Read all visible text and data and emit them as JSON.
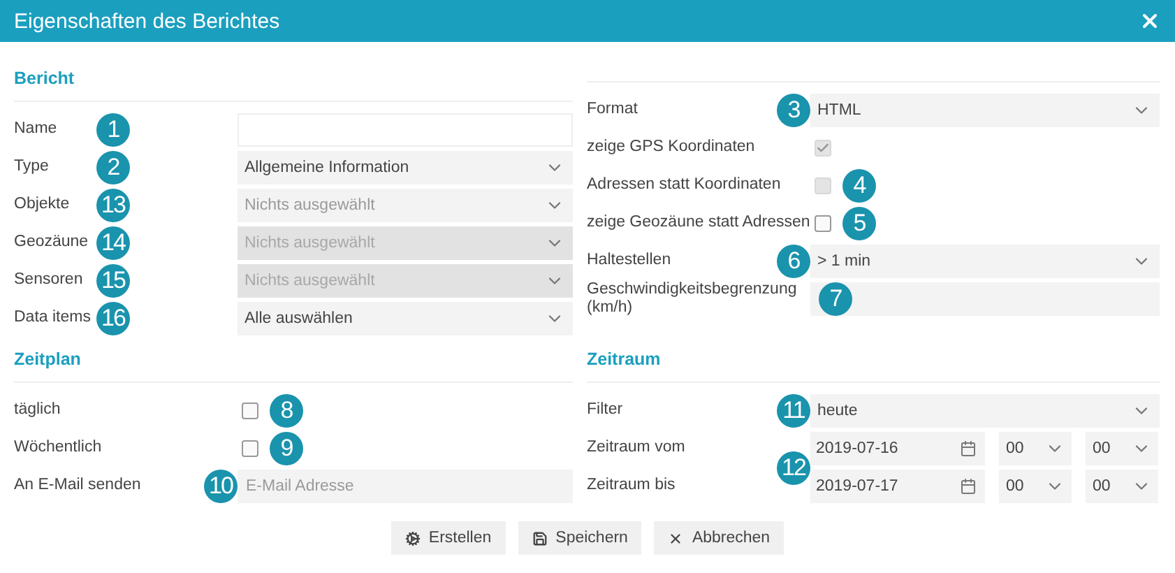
{
  "window": {
    "title": "Eigenschaften des Berichtes"
  },
  "bericht": {
    "title": "Bericht",
    "left": [
      {
        "kind": "text",
        "label": "Name",
        "badge": "1"
      },
      {
        "kind": "select",
        "label": "Type",
        "badge": "2",
        "value": "Allgemeine Information",
        "disabled": false
      },
      {
        "kind": "select",
        "label": "Objekte",
        "badge": "13",
        "placeholder": "Nichts ausgewählt",
        "disabled": false
      },
      {
        "kind": "select",
        "label": "Geozäune",
        "badge": "14",
        "placeholder": "Nichts ausgewählt",
        "disabled": true
      },
      {
        "kind": "select",
        "label": "Sensoren",
        "badge": "15",
        "placeholder": "Nichts ausgewählt",
        "disabled": true
      },
      {
        "kind": "select",
        "label": "Data items",
        "badge": "16",
        "value": "Alle auswählen",
        "disabled": false
      }
    ],
    "right": [
      {
        "kind": "select",
        "label": "Format",
        "badge": "3",
        "value": "HTML",
        "disabled": false
      },
      {
        "kind": "checkbox",
        "label": "zeige GPS Koordinaten",
        "checked": true,
        "disabled": true
      },
      {
        "kind": "checkbox",
        "label": "Adressen statt Koordinaten",
        "badge": "4",
        "checked": false,
        "disabled": true
      },
      {
        "kind": "checkbox",
        "label": "zeige Geozäune statt Adressen",
        "badge": "5",
        "checked": false,
        "disabled": false
      },
      {
        "kind": "select",
        "label": "Haltestellen",
        "badge": "6",
        "value": "> 1 min",
        "disabled": false
      },
      {
        "kind": "number",
        "label": "Geschwindigkeitsbegrenzung (km/h)",
        "badge": "7"
      }
    ]
  },
  "zeitplan": {
    "title": "Zeitplan",
    "rows": [
      {
        "kind": "checkbox",
        "label": "täglich",
        "badge": "8",
        "checked": false,
        "disabled": false
      },
      {
        "kind": "checkbox",
        "label": "Wöchentlich",
        "badge": "9",
        "checked": false,
        "disabled": false
      },
      {
        "kind": "text",
        "label": "An E-Mail senden",
        "badge": "10",
        "placeholder": "E-Mail Adresse"
      }
    ]
  },
  "zeitraum": {
    "title": "Zeitraum",
    "rows": [
      {
        "kind": "select",
        "label": "Filter",
        "badge": "11",
        "value": "heute",
        "disabled": false
      }
    ],
    "range_badge": "12",
    "dates": [
      {
        "label": "Zeitraum vom",
        "date": "2019-07-16",
        "hour": "00",
        "minute": "00"
      },
      {
        "label": "Zeitraum bis",
        "date": "2019-07-17",
        "hour": "00",
        "minute": "00"
      }
    ]
  },
  "buttons": [
    {
      "kind": "create",
      "label": "Erstellen"
    },
    {
      "kind": "save",
      "label": "Speichern"
    },
    {
      "kind": "cancel",
      "label": "Abbrechen"
    }
  ]
}
